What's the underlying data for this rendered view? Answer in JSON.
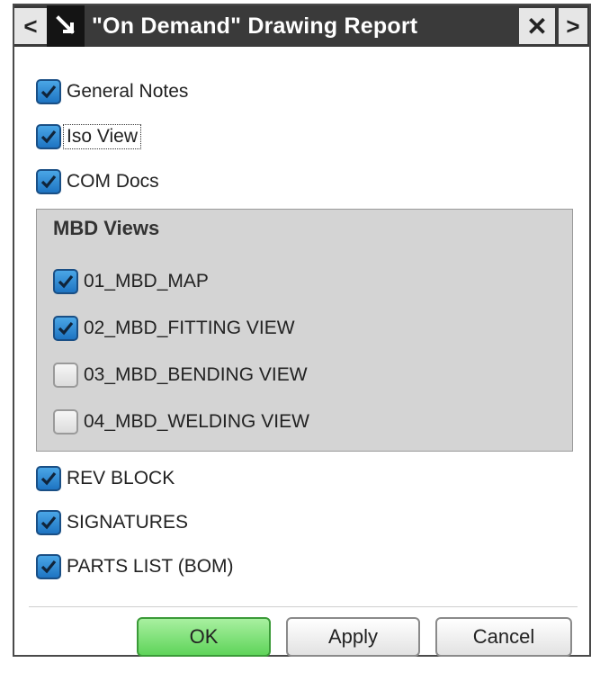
{
  "dialog": {
    "title": "\"On Demand\" Drawing Report",
    "back_glyph": "<",
    "forward_glyph": ">",
    "close_glyph": "✕"
  },
  "options": [
    {
      "label": "General Notes",
      "checked": true
    },
    {
      "label": "Iso View",
      "checked": true
    },
    {
      "label": "COM Docs",
      "checked": true
    }
  ],
  "mbd_group": {
    "title": "MBD Views",
    "items": [
      {
        "label": "01_MBD_MAP",
        "checked": true
      },
      {
        "label": "02_MBD_FITTING VIEW",
        "checked": true
      },
      {
        "label": "03_MBD_BENDING VIEW",
        "checked": false
      },
      {
        "label": "04_MBD_WELDING VIEW",
        "checked": false
      }
    ]
  },
  "options_after": [
    {
      "label": "REV BLOCK",
      "checked": true
    },
    {
      "label": "SIGNATURES",
      "checked": true
    },
    {
      "label": "PARTS LIST (BOM)",
      "checked": true
    }
  ],
  "buttons": {
    "ok": "OK",
    "apply": "Apply",
    "cancel": "Cancel"
  },
  "colors": {
    "checkbox_checked": "#2f8ad6",
    "ok_button": "#6fdc68",
    "title_bar": "#141414"
  },
  "icons": {
    "back": "chevron-left-icon",
    "pin": "pin-arrow-icon",
    "close": "close-icon",
    "forward": "chevron-right-icon",
    "check": "checkmark-icon"
  }
}
